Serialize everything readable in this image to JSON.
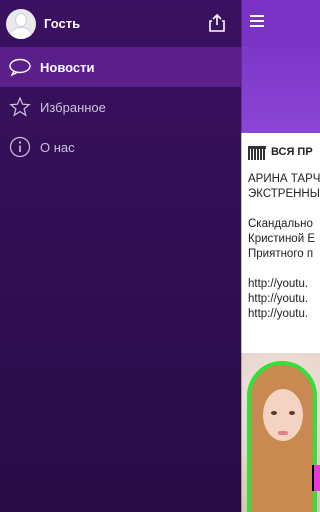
{
  "drawer": {
    "user_name": "Гость",
    "items": [
      {
        "label": "Новости",
        "icon": "chat-bubble-icon",
        "active": true
      },
      {
        "label": "Избранное",
        "icon": "star-icon",
        "active": false
      },
      {
        "label": "О нас",
        "icon": "info-icon",
        "active": false
      }
    ]
  },
  "content": {
    "post_title": "ВСЯ ПР",
    "post_lines": [
      "АРИНА ТАРЧ",
      "ЭКСТРЕННЫ",
      "",
      "Скандально",
      "Кристиной Е",
      "Приятного п",
      "",
      "http://youtu.",
      "http://youtu.",
      "http://youtu."
    ]
  },
  "colors": {
    "drawer_bg": "#2f0e50",
    "active_item_bg": "#5b1f8c",
    "topbar": "#7a33c4",
    "photo_border": "#33e03a"
  }
}
